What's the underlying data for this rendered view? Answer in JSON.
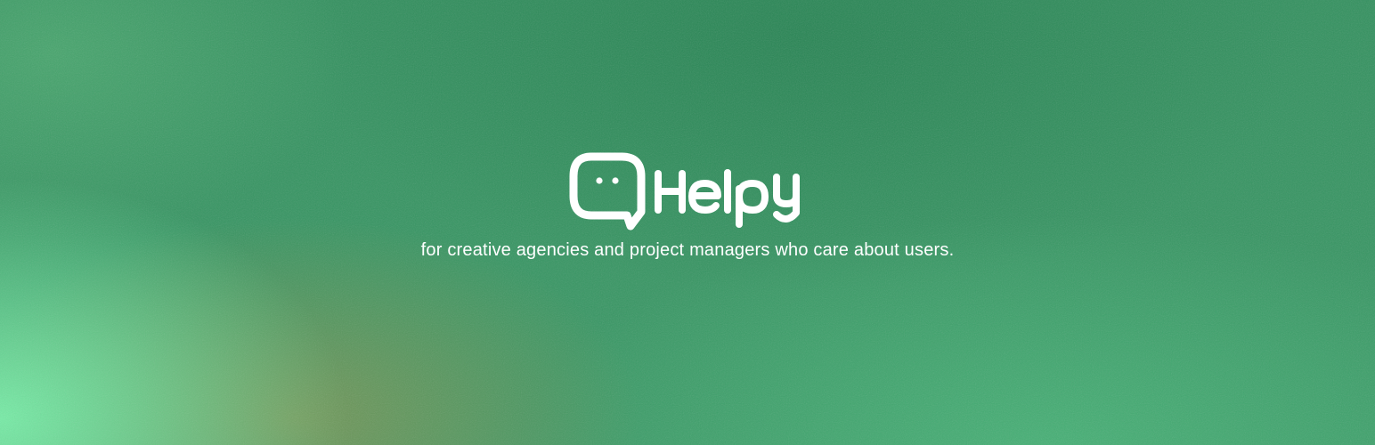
{
  "brand": {
    "name": "Helpy",
    "logo_icon": "speech-bubble-icon"
  },
  "tagline": "for creative agencies and project managers who care about users.",
  "colors": {
    "text": "#ffffff",
    "background_base": "#33915f",
    "background_light": "#7af0aa",
    "background_olive": "#7e9656",
    "background_dark": "#24804f"
  }
}
